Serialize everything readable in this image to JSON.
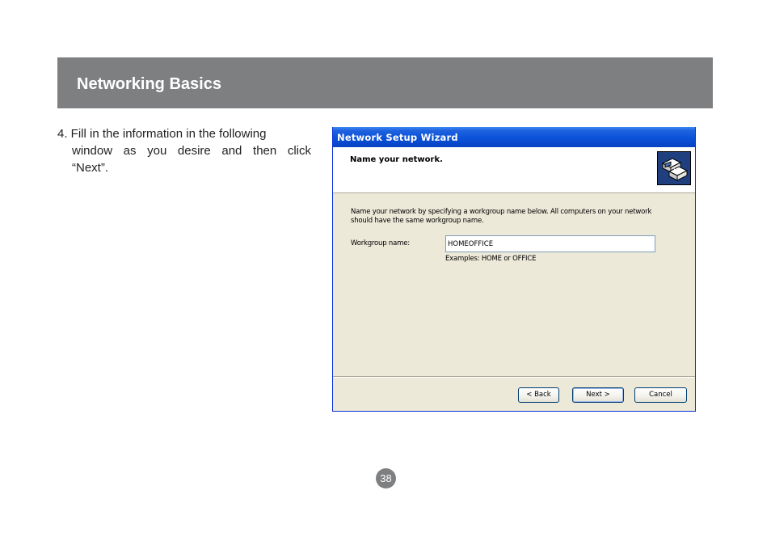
{
  "header": {
    "title": "Networking Basics",
    "band_color": "#7d7f81"
  },
  "instruction": {
    "line1": "4. Fill in the information in the following",
    "line2": "window as you desire and then click",
    "line3": "“Next”."
  },
  "wizard": {
    "title": "Network Setup Wizard",
    "heading": "Name your network.",
    "icon": "network-computers-icon",
    "description_line1": "Name your network by specifying a workgroup name below. All computers on your network",
    "description_line2": "should have the same workgroup name.",
    "workgroup_label": "Workgroup name:",
    "workgroup_value": "HOMEOFFICE",
    "examples": "Examples: HOME or OFFICE",
    "buttons": {
      "back": "< Back",
      "next": "Next >",
      "cancel": "Cancel"
    },
    "titlebar_color": "#0a52d9",
    "body_color": "#ece9d8"
  },
  "page_number": "38"
}
